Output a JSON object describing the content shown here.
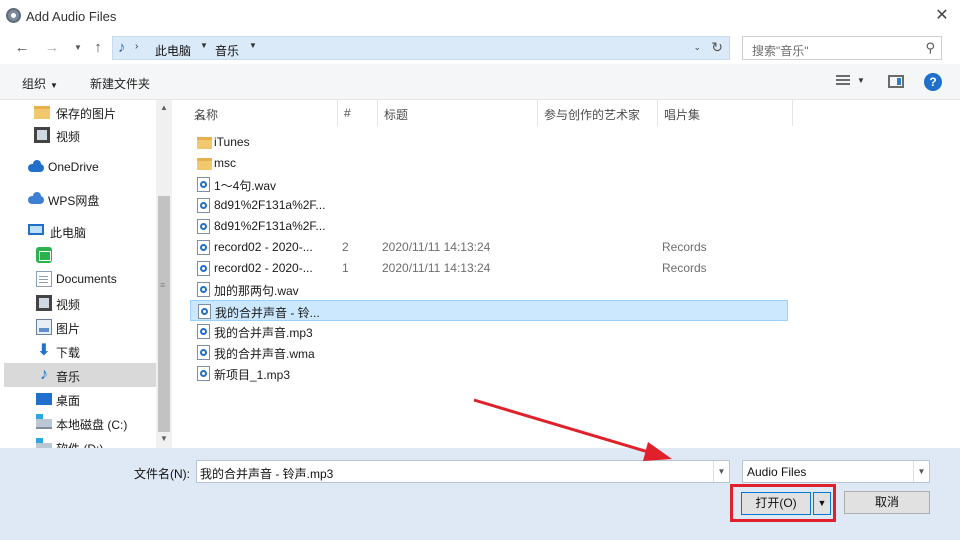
{
  "window": {
    "title": "Add Audio Files"
  },
  "address": {
    "crumbs": [
      "此电脑",
      "音乐"
    ],
    "search_placeholder": "搜索\"音乐\""
  },
  "toolbar": {
    "organize": "组织",
    "new_folder": "新建文件夹"
  },
  "nav": {
    "items": [
      {
        "label": "保存的图片",
        "icon": "folder-icon"
      },
      {
        "label": "视频",
        "icon": "video-icon"
      },
      {
        "label": "OneDrive",
        "icon": "cloud-icon"
      },
      {
        "label": "WPS网盘",
        "icon": "wps-cloud-icon"
      },
      {
        "label": "此电脑",
        "icon": "computer-icon"
      },
      {
        "label": "",
        "icon": "app-green-icon"
      },
      {
        "label": "Documents",
        "icon": "document-icon"
      },
      {
        "label": "视频",
        "icon": "video-icon"
      },
      {
        "label": "图片",
        "icon": "picture-icon"
      },
      {
        "label": "下载",
        "icon": "download-icon"
      },
      {
        "label": "音乐",
        "icon": "music-icon",
        "selected": true
      },
      {
        "label": "桌面",
        "icon": "desktop-icon"
      },
      {
        "label": "本地磁盘 (C:)",
        "icon": "drive-icon"
      },
      {
        "label": "软件 (D:)",
        "icon": "drive-icon"
      }
    ]
  },
  "files": {
    "columns": [
      "名称",
      "#",
      "标题",
      "参与创作的艺术家",
      "唱片集"
    ],
    "rows": [
      {
        "name": "iTunes",
        "num": "",
        "title": "",
        "artist": "",
        "album": "",
        "type": "folder"
      },
      {
        "name": "msc",
        "num": "",
        "title": "",
        "artist": "",
        "album": "",
        "type": "folder"
      },
      {
        "name": "1～4句.wav",
        "num": "",
        "title": "",
        "artist": "",
        "album": "",
        "type": "audio"
      },
      {
        "name": "8d91%2F131a%2F...",
        "num": "",
        "title": "",
        "artist": "",
        "album": "",
        "type": "audio"
      },
      {
        "name": "8d91%2F131a%2F...",
        "num": "",
        "title": "",
        "artist": "",
        "album": "",
        "type": "audio"
      },
      {
        "name": "record02 - 2020-...",
        "num": "2",
        "title": "2020/11/11 14:13:24",
        "artist": "",
        "album": "Records",
        "type": "audio"
      },
      {
        "name": "record02 - 2020-...",
        "num": "1",
        "title": "2020/11/11 14:13:24",
        "artist": "",
        "album": "Records",
        "type": "audio"
      },
      {
        "name": "加的那两句.wav",
        "num": "",
        "title": "",
        "artist": "",
        "album": "",
        "type": "audio"
      },
      {
        "name": "我的合并声音 - 铃...",
        "num": "",
        "title": "",
        "artist": "",
        "album": "",
        "type": "audio",
        "selected": true
      },
      {
        "name": "我的合并声音.mp3",
        "num": "",
        "title": "",
        "artist": "",
        "album": "",
        "type": "audio"
      },
      {
        "name": "我的合并声音.wma",
        "num": "",
        "title": "",
        "artist": "",
        "album": "",
        "type": "audio"
      },
      {
        "name": "新项目_1.mp3",
        "num": "",
        "title": "",
        "artist": "",
        "album": "",
        "type": "audio"
      }
    ]
  },
  "bottom": {
    "filename_label": "文件名(N):",
    "filename_value": "我的合并声音 - 铃声.mp3",
    "filetype_value": "Audio Files",
    "open_label": "打开(O)",
    "cancel_label": "取消"
  },
  "colors": {
    "highlight": "#e0202a",
    "selection": "#cce8ff",
    "accent": "#1f6fcb"
  }
}
